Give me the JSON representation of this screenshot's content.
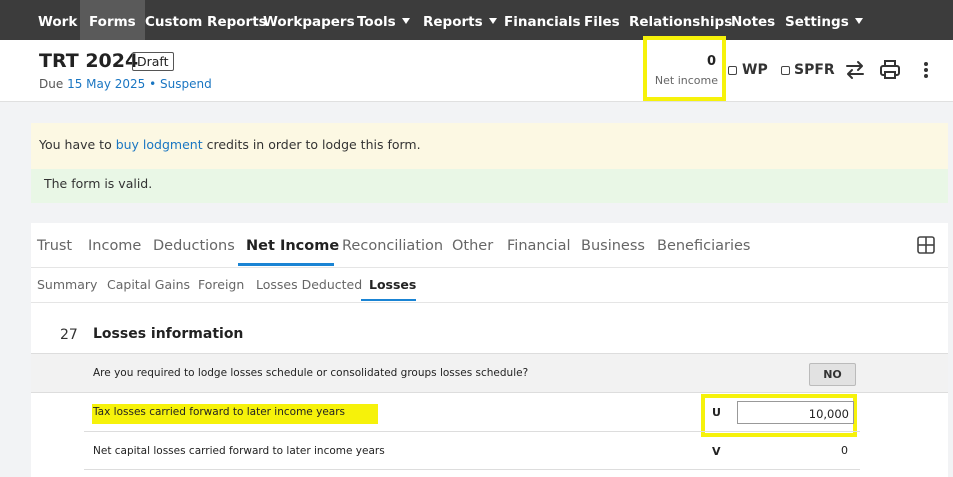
{
  "nav": {
    "items": [
      {
        "label": "Work"
      },
      {
        "label": "Forms"
      },
      {
        "label": "Custom Reports"
      },
      {
        "label": "Workpapers"
      },
      {
        "label": "Tools"
      },
      {
        "label": "Reports"
      },
      {
        "label": "Financials"
      },
      {
        "label": "Files"
      },
      {
        "label": "Relationships"
      },
      {
        "label": "Notes"
      },
      {
        "label": "Settings"
      }
    ],
    "active": "Forms"
  },
  "header": {
    "title": "TRT 2024",
    "badge": "Draft",
    "due_prefix": "Due",
    "due_date": "15 May 2025",
    "separator": "•",
    "suspend_label": "Suspend",
    "net_income_value": "0",
    "net_income_label": "Net income",
    "wp_label": "WP",
    "spfr_label": "SPFR"
  },
  "alerts": {
    "warning_before": "You have to",
    "warning_link": "buy lodgment",
    "warning_after": "credits in order to lodge this form.",
    "valid_text": "The form is valid."
  },
  "tabs": [
    {
      "label": "Trust"
    },
    {
      "label": "Income"
    },
    {
      "label": "Deductions"
    },
    {
      "label": "Net Income"
    },
    {
      "label": "Reconciliation"
    },
    {
      "label": "Other"
    },
    {
      "label": "Financial"
    },
    {
      "label": "Business"
    },
    {
      "label": "Beneficiaries"
    }
  ],
  "subtabs": [
    {
      "label": "Summary"
    },
    {
      "label": "Capital Gains"
    },
    {
      "label": "Foreign"
    },
    {
      "label": "Losses Deducted"
    },
    {
      "label": "Losses"
    }
  ],
  "section": {
    "number": "27",
    "title": "Losses information",
    "question1": "Are you required to lodge losses schedule or consolidated groups losses schedule?",
    "question1_answer": "NO",
    "question2": "Tax losses carried forward to later income years",
    "question2_code": "U",
    "question2_value": "10,000",
    "question3": "Net capital losses carried forward to later income years",
    "question3_code": "V",
    "question3_value": "0"
  },
  "colors": {
    "nav_bg": "#3c3c3c",
    "highlight": "#f6f20a",
    "accent": "#1a84d4",
    "warning_bg": "#fcf8e3",
    "success_bg": "#e9f7e6"
  }
}
